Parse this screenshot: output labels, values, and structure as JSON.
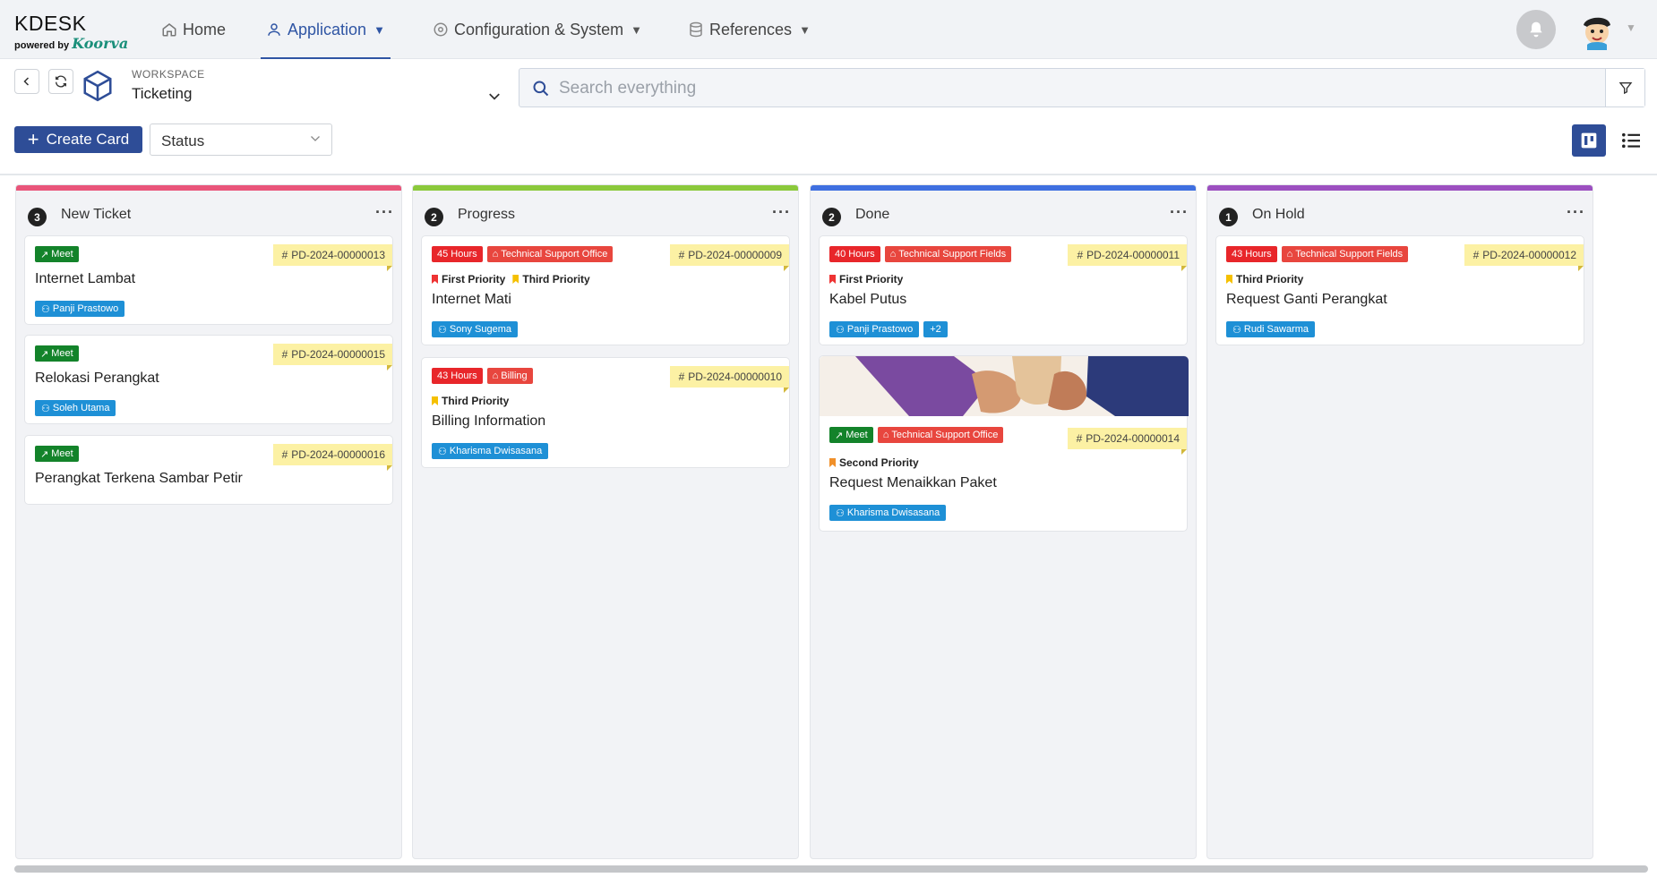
{
  "brand": {
    "name": "KDESK",
    "powered_by": "powered by",
    "partner": "Koorva"
  },
  "nav": {
    "home": "Home",
    "application": "Application",
    "config": "Configuration & System",
    "references": "References"
  },
  "workspace": {
    "label": "WORKSPACE",
    "value": "Ticketing"
  },
  "search": {
    "placeholder": "Search everything"
  },
  "toolbar": {
    "create_label": "Create Card",
    "status_label": "Status"
  },
  "colors": {
    "primary": "#2e4d97",
    "new": "#e9557a",
    "progress": "#8bc93b",
    "done": "#3f6fe0",
    "hold": "#9c4fc0"
  },
  "columns": [
    {
      "name": "New Ticket",
      "count": "3",
      "cards": [
        {
          "badge": "Meet",
          "id": "PD-2024-00000013",
          "title": "Internet Lambat",
          "assignee": "Panji Prastowo"
        },
        {
          "badge": "Meet",
          "id": "PD-2024-00000015",
          "title": "Relokasi Perangkat",
          "assignee": "Soleh Utama"
        },
        {
          "badge": "Meet",
          "id": "PD-2024-00000016",
          "title": "Perangkat Terkena Sambar Petir"
        }
      ]
    },
    {
      "name": "Progress",
      "count": "2",
      "cards": [
        {
          "hours": "45 Hours",
          "office": "Technical Support Office",
          "id": "PD-2024-00000009",
          "prio1": "First Priority",
          "prio2": "Third Priority",
          "title": "Internet Mati",
          "assignee": "Sony Sugema"
        },
        {
          "hours": "43 Hours",
          "office": "Billing",
          "id": "PD-2024-00000010",
          "prio1": "Third Priority",
          "title": "Billing Information",
          "assignee": "Kharisma Dwisasana"
        }
      ]
    },
    {
      "name": "Done",
      "count": "2",
      "cards": [
        {
          "hours": "40 Hours",
          "office": "Technical Support Fields",
          "id": "PD-2024-00000011",
          "prio1": "First Priority",
          "title": "Kabel Putus",
          "assignee": "Panji Prastowo",
          "extra": "+2"
        },
        {
          "badge": "Meet",
          "office": "Technical Support Office",
          "id": "PD-2024-00000014",
          "prio1": "Second Priority",
          "title": "Request Menaikkan Paket",
          "assignee": "Kharisma Dwisasana"
        }
      ]
    },
    {
      "name": "On Hold",
      "count": "1",
      "cards": [
        {
          "hours": "43 Hours",
          "office": "Technical Support Fields",
          "id": "PD-2024-00000012",
          "prio1": "Third Priority",
          "title": "Request Ganti Perangkat",
          "assignee": "Rudi Sawarma"
        }
      ]
    }
  ]
}
